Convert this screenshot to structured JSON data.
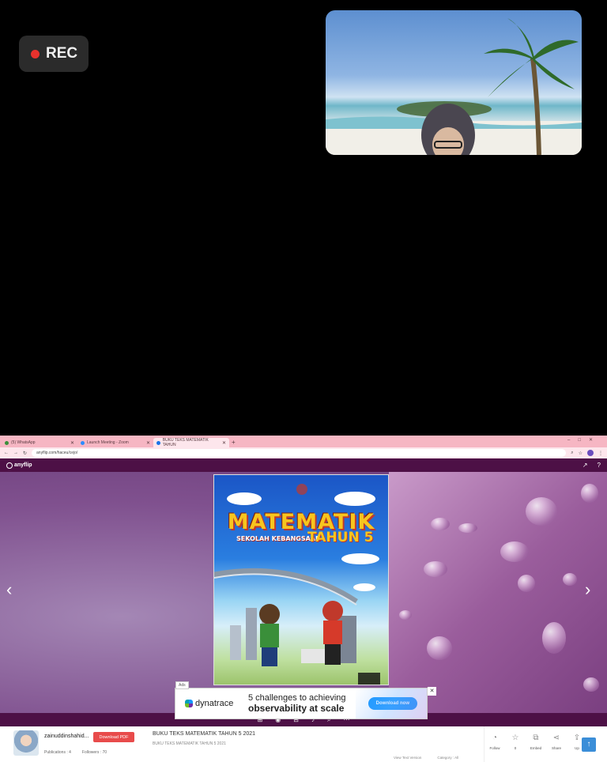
{
  "rec": {
    "label": "REC",
    "dot_color": "#e8322d"
  },
  "browser": {
    "tabs": [
      {
        "label": "(5) WhatsApp"
      },
      {
        "label": "Launch Meeting - Zoom"
      },
      {
        "label": "BUKU TEKS MATEMATIK TAHUN"
      }
    ],
    "new_tab": "+",
    "url": "anyflip.com/haceu/cejo/"
  },
  "app": {
    "logo": "anyflip"
  },
  "book": {
    "title": "MATEMATIK",
    "subtitle": "SEKOLAH KEBANGSAAN",
    "tahun": "TAHUN 5"
  },
  "ad": {
    "tag": "Ads",
    "brand": "dynatrace",
    "line1": "5 challenges to achieving",
    "line2": "observability at scale",
    "cta": "Download now",
    "close": "✕"
  },
  "info": {
    "author": "zainuddinshahid...",
    "download_label": "Download PDF",
    "publications": "Publications : 4",
    "followers": "Followers : 70",
    "title": "BUKU TEKS MATEMATIK TAHUN 5 2021",
    "subtitle": "BUKU TEKS MATEMATIK TAHUN 5 2021",
    "views": "View Text Version",
    "category": "Category : All",
    "actions": [
      {
        "label": "Follow",
        "icon": "rss-icon"
      },
      {
        "label": "0",
        "icon": "star-icon"
      },
      {
        "label": "Embed",
        "icon": "embed-icon"
      },
      {
        "label": "Share",
        "icon": "share-icon"
      },
      {
        "label": "Up",
        "icon": "upload-icon"
      }
    ]
  },
  "colors": {
    "appbar": "#4d1046",
    "tabbar": "#f6b6c3",
    "download_button": "#e84b4b"
  }
}
